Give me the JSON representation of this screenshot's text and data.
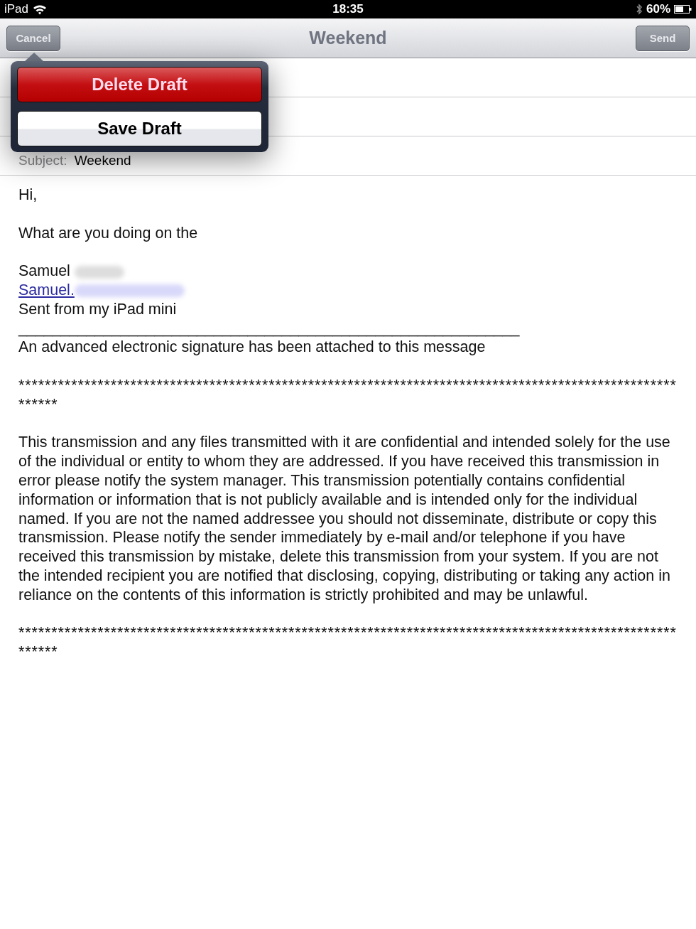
{
  "status_bar": {
    "carrier": "iPad",
    "time": "18:35",
    "battery": "60%"
  },
  "nav_bar": {
    "title": "Weekend",
    "left_button": "Cancel",
    "right_button": "Send"
  },
  "fields": [
    {
      "label": "Subject:",
      "value": "Weekend"
    }
  ],
  "popover": {
    "actions": [
      {
        "label": "Delete Draft",
        "kind": "destructive"
      },
      {
        "label": "Save Draft",
        "kind": "default"
      }
    ]
  },
  "body": [
    {
      "kind": "text",
      "text": "Hi,"
    },
    {
      "kind": "blank"
    },
    {
      "kind": "text",
      "text": "What are you doing on the"
    },
    {
      "kind": "blank"
    },
    {
      "kind": "redacted",
      "text": "Samuel"
    },
    {
      "kind": "redacted-link",
      "text": "Samuel."
    },
    {
      "kind": "text",
      "text": "Sent from my iPad mini"
    },
    {
      "kind": "text",
      "text": "___________________________________________________________"
    },
    {
      "kind": "text",
      "text": "An advanced electronic signature has been attached to this message"
    },
    {
      "kind": "blank"
    },
    {
      "kind": "stars",
      "text": "**********************************************************************************************************"
    },
    {
      "kind": "blank"
    },
    {
      "kind": "text",
      "text": "This transmission and any files transmitted with it are confidential and intended solely for the use of the individual or entity to whom they are addressed. If you have received this transmission in error please notify the system manager. This transmission potentially contains confidential information or information that is not publicly available and is intended only for the individual named. If you are not the named addressee you should not disseminate, distribute or copy this transmission. Please notify the sender immediately by e-mail and/or telephone if you have received this transmission by mistake, delete this transmission from your system. If you are not the intended recipient you are notified that disclosing, copying, distributing or taking any action in reliance on the contents of this information is strictly prohibited and may be unlawful."
    },
    {
      "kind": "blank"
    },
    {
      "kind": "stars",
      "text": "**********************************************************************************************************"
    }
  ]
}
